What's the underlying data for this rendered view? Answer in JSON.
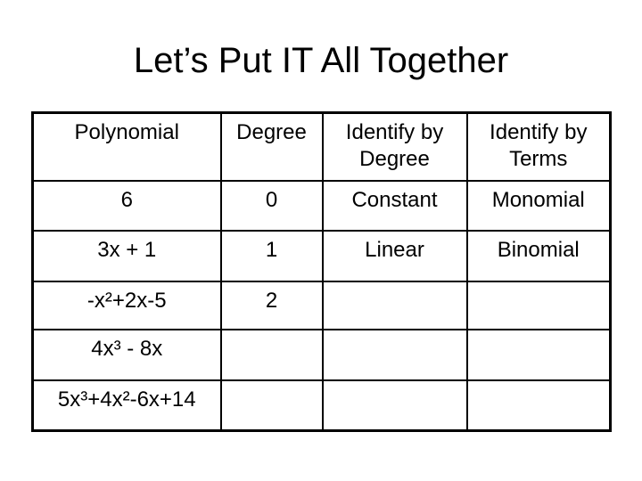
{
  "title": "Let’s Put IT All Together",
  "table": {
    "headers": [
      "Polynomial",
      "Degree",
      "Identify by Degree",
      "Identify by Terms"
    ],
    "rows": [
      {
        "polynomial": "6",
        "degree": "0",
        "by_degree": "Constant",
        "by_terms": "Monomial"
      },
      {
        "polynomial": "3x + 1",
        "degree": "1",
        "by_degree": "Linear",
        "by_terms": "Binomial"
      },
      {
        "polynomial": "-x²+2x-5",
        "degree": "2",
        "by_degree": "",
        "by_terms": ""
      },
      {
        "polynomial": "4x³ - 8x",
        "degree": "",
        "by_degree": "",
        "by_terms": ""
      },
      {
        "polynomial": "5x³+4x²-6x+14",
        "degree": "",
        "by_degree": "",
        "by_terms": ""
      }
    ]
  }
}
